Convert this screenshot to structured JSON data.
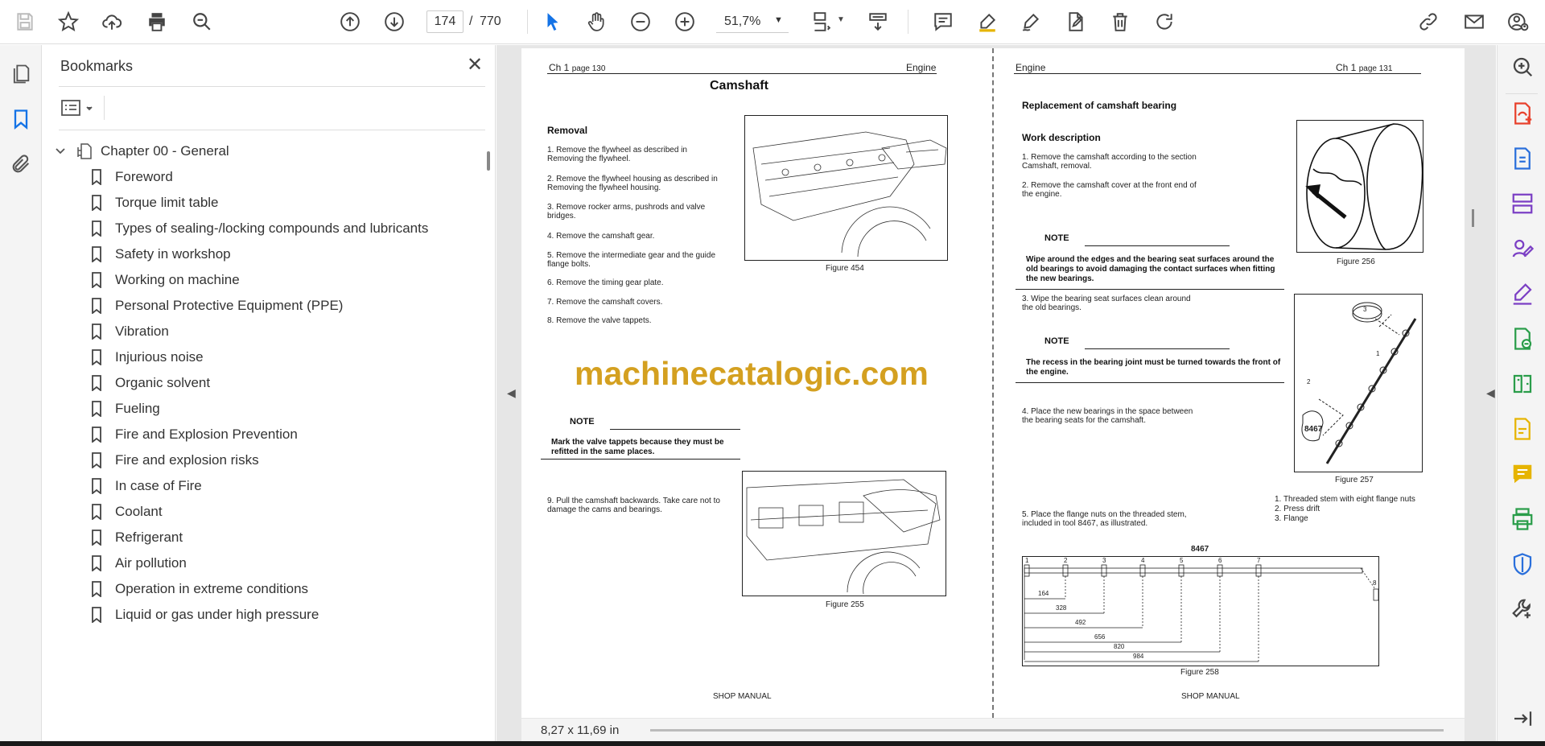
{
  "toolbar": {
    "current_page": "174",
    "page_separator": "/",
    "total_pages": "770",
    "zoom": "51,7%",
    "icons": [
      "save-icon",
      "star-icon",
      "upload-icon",
      "print-icon",
      "search-icon",
      "arrow-up-icon",
      "arrow-down-icon",
      "pointer-icon",
      "hand-icon",
      "zoom-out-icon",
      "zoom-in-icon",
      "page-fit-icon",
      "scroll-mode-icon",
      "comment-icon",
      "highlight-icon",
      "draw-icon",
      "edit-icon",
      "delete-icon",
      "rotate-icon",
      "link-icon",
      "mail-icon",
      "account-icon"
    ]
  },
  "left_rail": {
    "icons": [
      "pages-icon",
      "bookmark-icon",
      "attachment-icon"
    ]
  },
  "bookmarks": {
    "title": "Bookmarks",
    "chapter": "Chapter 00 - General",
    "items": [
      "Foreword",
      "Torque limit table",
      "Types of sealing-/locking compounds and lubricants",
      "Safety in workshop",
      "Working on machine",
      "Personal Protective Equipment (PPE)",
      "Vibration",
      "Injurious noise",
      "Organic solvent",
      "Fueling",
      "Fire and Explosion Prevention",
      "Fire and explosion risks",
      "In case of Fire",
      "Coolant",
      "Refrigerant",
      "Air pollution",
      "Operation in extreme conditions",
      "Liquid or gas under high pressure"
    ]
  },
  "document": {
    "left_page": {
      "header_left_ch": "Ch 1",
      "header_left_page": "page 130",
      "header_right": "Engine",
      "title": "Camshaft",
      "section": "Removal",
      "steps": [
        "1. Remove the flywheel as described in Removing the flywheel.",
        "2. Remove the flywheel housing as described in Removing the flywheel housing.",
        "3. Remove rocker arms, pushrods and valve bridges.",
        "4. Remove the camshaft gear.",
        "5. Remove the intermediate gear and the guide flange bolts.",
        "6. Remove the timing gear plate.",
        "7. Remove the camshaft covers.",
        "8. Remove the valve tappets."
      ],
      "note_label": "NOTE",
      "note_text": "Mark the valve tappets because they must be refitted in the same places.",
      "step9": "9. Pull the camshaft backwards. Take care not to damage the cams and bearings.",
      "fig1": "Figure 454",
      "fig2": "Figure 255",
      "footer": "SHOP MANUAL",
      "watermark": "machinecatalogic.com"
    },
    "right_page": {
      "header_left": "Engine",
      "header_right_ch": "Ch 1",
      "header_right_page": "page 131",
      "title": "Replacement of camshaft bearing",
      "section": "Work description",
      "step1": "1. Remove the camshaft according to the section Camshaft, removal.",
      "step2": "2. Remove the camshaft cover at the front end of the engine.",
      "note1_label": "NOTE",
      "note1_text": "Wipe around the edges and the bearing seat surfaces around the old bearings to avoid damaging the contact surfaces when fitting the new bearings.",
      "step3": "3. Wipe the bearing seat surfaces clean around the old bearings.",
      "note2_label": "NOTE",
      "note2_text": "The recess in the bearing joint must be turned towards the front of the engine.",
      "step4": "4. Place the new bearings in the space between the bearing seats for the camshaft.",
      "step5": "5. Place the flange nuts on the threaded stem, included in tool 8467, as illustrated.",
      "legend": [
        "1. Threaded stem with eight flange nuts",
        "2. Press drift",
        "3. Flange"
      ],
      "fig256": "Figure 256",
      "fig257": "Figure 257",
      "fig257_labels": [
        "3",
        "1",
        "2",
        "8467"
      ],
      "fig258": "Figure 258",
      "fig258_title": "8467",
      "fig258_positions": [
        "1",
        "2",
        "3",
        "4",
        "5",
        "6",
        "7",
        "8"
      ],
      "fig258_dims": [
        "164",
        "328",
        "492",
        "656",
        "820",
        "984"
      ],
      "footer": "SHOP MANUAL"
    }
  },
  "status": {
    "page_size": "8,27 x 11,69 in"
  },
  "right_rail": {
    "icons": [
      "zoom-search-icon",
      "export-pdf-icon",
      "create-pdf-icon",
      "organize-pages-icon",
      "request-signature-icon",
      "fill-sign-icon",
      "compress-pdf-icon",
      "compare-icon",
      "scan-ocr-icon",
      "comment-tool-icon",
      "print-production-icon",
      "protect-icon",
      "more-tools-icon",
      "collapse-panel-icon"
    ],
    "colors": {
      "red": "#e8412c",
      "blue": "#2a6fdb",
      "purple": "#7b3fc4",
      "green": "#2a9d4a",
      "yellow": "#e6b400",
      "gray": "#444444"
    }
  }
}
